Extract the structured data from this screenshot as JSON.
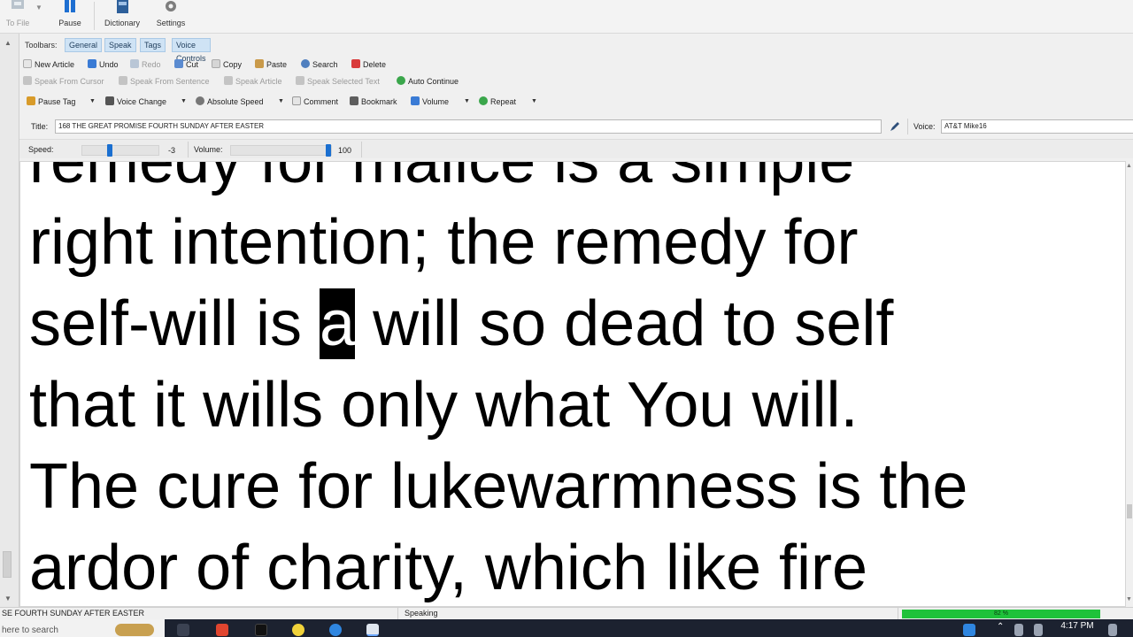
{
  "ribbon": {
    "to_file": "To File",
    "pause": "Pause",
    "dictionary": "Dictionary",
    "settings": "Settings"
  },
  "toolbars": {
    "label": "Toolbars:",
    "tabs": [
      "General",
      "Speak",
      "Tags",
      "Voice Controls"
    ]
  },
  "row1": {
    "new_article": "New Article",
    "undo": "Undo",
    "redo": "Redo",
    "cut": "Cut",
    "copy": "Copy",
    "paste": "Paste",
    "search": "Search",
    "delete": "Delete"
  },
  "row2": {
    "speak_from_cursor": "Speak From Cursor",
    "speak_from_sentence": "Speak From Sentence",
    "speak_article": "Speak Article",
    "speak_selected_text": "Speak Selected Text",
    "auto_continue": "Auto Continue"
  },
  "row3": {
    "pause_tag": "Pause Tag",
    "voice_change": "Voice Change",
    "absolute_speed": "Absolute Speed",
    "comment": "Comment",
    "bookmark": "Bookmark",
    "volume": "Volume",
    "repeat": "Repeat"
  },
  "title_row": {
    "title_label": "Title:",
    "title_value": "168 THE GREAT PROMISE FOURTH SUNDAY AFTER EASTER",
    "voice_label": "Voice:",
    "voice_value": "AT&T Mike16"
  },
  "speed_row": {
    "speed_label": "Speed:",
    "speed_value": "-3",
    "speed_level": 0.35,
    "volume_label": "Volume:",
    "volume_value": "100",
    "volume_level": 1.0
  },
  "document": {
    "lines": [
      {
        "before": "remedy for malice is a simple",
        "highlight": "",
        "after": ""
      },
      {
        "before": "right intention; the remedy for",
        "highlight": "",
        "after": ""
      },
      {
        "before": "self-will is ",
        "highlight": "a",
        "after": " will so dead to self"
      },
      {
        "before": "that it wills only what You will.",
        "highlight": "",
        "after": ""
      },
      {
        "before": "The cure for lukewarmness is the",
        "highlight": "",
        "after": ""
      },
      {
        "before": "ardor of charity, which like fire",
        "highlight": "",
        "after": ""
      }
    ]
  },
  "status": {
    "article": "SE FOURTH SUNDAY AFTER EASTER",
    "state": "Speaking",
    "progress_text": "82 %",
    "progress": 0.82
  },
  "taskbar": {
    "search_text": "here to search",
    "time": "4:17 PM"
  },
  "colors": {
    "tab_bg": "#cfe3f5",
    "slider_knob": "#1a6fd0",
    "progress": "#1fc23a",
    "taskbar": "#1c2230"
  }
}
